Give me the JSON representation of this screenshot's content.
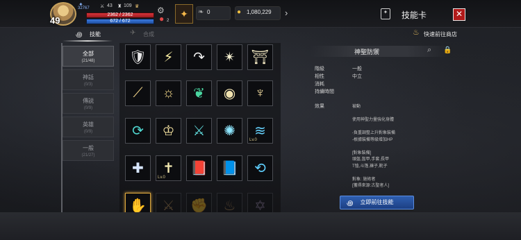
{
  "player": {
    "level": "49",
    "power": "32767",
    "attack": "43",
    "defense": "109",
    "hp": "2362 / 2362",
    "mp": "672 / 672",
    "potion_count": "2"
  },
  "currency": {
    "secondary_value": "0",
    "gold_value": "1,080,229"
  },
  "header": {
    "title": "技能卡",
    "close_label": "✕"
  },
  "tabs": [
    {
      "label": "技能",
      "active": true
    },
    {
      "label": "合成",
      "active": false
    }
  ],
  "shop_link": "快速前往商店",
  "categories": [
    {
      "name": "全部",
      "count": "(21/48)",
      "active": true
    },
    {
      "name": "神話",
      "count": "(0/3)",
      "active": false
    },
    {
      "name": "傳説",
      "count": "(0/9)",
      "active": false
    },
    {
      "name": "英雄",
      "count": "(0/9)",
      "active": false
    },
    {
      "name": "一般",
      "count": "(21/27)",
      "active": false
    }
  ],
  "skills": [
    {
      "icon": "shield-icon",
      "glyph": "🛡",
      "color": "#e8e8e8",
      "level": ""
    },
    {
      "icon": "lightning-icon",
      "glyph": "⚡",
      "color": "#f4e9a0",
      "level": ""
    },
    {
      "icon": "curve-arrow-icon",
      "glyph": "↷",
      "color": "#f0f0f0",
      "level": ""
    },
    {
      "icon": "starburst-icon",
      "glyph": "✴",
      "color": "#f5f0d0",
      "level": ""
    },
    {
      "icon": "altar-icon",
      "glyph": "⛩",
      "color": "#f0e6c0",
      "level": ""
    },
    {
      "icon": "slash-icon",
      "glyph": "⟋",
      "color": "#f3d58a",
      "level": ""
    },
    {
      "icon": "sun-gear-icon",
      "glyph": "☼",
      "color": "#f4d98a",
      "level": ""
    },
    {
      "icon": "leaf-sword-icon",
      "glyph": "❦",
      "color": "#4ad6a0",
      "level": ""
    },
    {
      "icon": "orb-icon",
      "glyph": "◉",
      "color": "#f0e2b0",
      "level": ""
    },
    {
      "icon": "helm-icon",
      "glyph": "♆",
      "color": "#f2dca0",
      "level": ""
    },
    {
      "icon": "cycle-icon",
      "glyph": "⟳",
      "color": "#4fd7d0",
      "level": ""
    },
    {
      "icon": "sparkle-city-icon",
      "glyph": "♔",
      "color": "#f4e2a0",
      "level": ""
    },
    {
      "icon": "blade-icon",
      "glyph": "⚔",
      "color": "#5fd7d9",
      "level": ""
    },
    {
      "icon": "vortex-icon",
      "glyph": "✺",
      "color": "#8fe7ff",
      "level": ""
    },
    {
      "icon": "whirlwind-icon",
      "glyph": "≋",
      "color": "#66d3ff",
      "level": "Lv.0"
    },
    {
      "icon": "cross-shield-icon",
      "glyph": "✚",
      "color": "#d7e6ff",
      "level": ""
    },
    {
      "icon": "holy-sword-icon",
      "glyph": "✝",
      "color": "#f2e8b0",
      "level": "Lv.0"
    },
    {
      "icon": "red-book-icon",
      "glyph": "📕",
      "color": "#e04848",
      "level": ""
    },
    {
      "icon": "blue-book-icon",
      "glyph": "📘",
      "color": "#5b9be0",
      "level": ""
    },
    {
      "icon": "scroll-icon",
      "glyph": "⟲",
      "color": "#5fd0ff",
      "level": ""
    },
    {
      "icon": "holy-hand-icon",
      "glyph": "✋",
      "color": "#f0d070",
      "level": ""
    },
    {
      "icon": "dim-sword-icon",
      "glyph": "⚔",
      "color": "#b08850",
      "level": ""
    },
    {
      "icon": "dim-fist-icon",
      "glyph": "✊",
      "color": "#b08850",
      "level": ""
    },
    {
      "icon": "dim-flame-icon",
      "glyph": "♨",
      "color": "#b08850",
      "level": ""
    },
    {
      "icon": "dim-star-icon",
      "glyph": "✡",
      "color": "#8a7a9a",
      "level": ""
    }
  ],
  "detail": {
    "name": "神聖防禦",
    "rows": [
      {
        "label": "階級",
        "value": "一般"
      },
      {
        "label": "相性",
        "value": "中立"
      },
      {
        "label": "消耗",
        "value": ""
      },
      {
        "label": "持續時間",
        "value": ""
      }
    ],
    "effect_label": "效果",
    "effect_lines": [
      "被動",
      "",
      "使用神聖力量強化身體",
      "",
      "-負重調整上升對象裝備",
      "-根據裝備等級增加HP",
      "",
      "[對象裝備]",
      "頭盔,盔甲,手套,長甲",
      "T恤,斗篷,褲子,靴子",
      "",
      "對象: 施術者",
      "[獲得來源:古聖者人]"
    ],
    "go_button": "立即前往技能"
  }
}
